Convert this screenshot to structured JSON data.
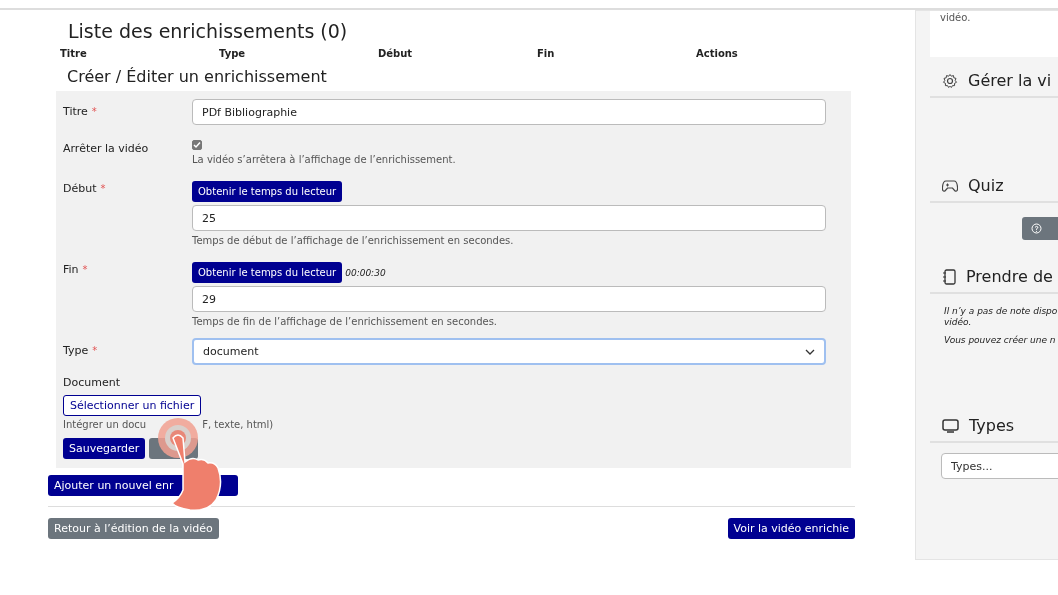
{
  "list": {
    "title": "Liste des enrichissements (0)",
    "columns": [
      "Titre",
      "Type",
      "Début",
      "Fin",
      "Actions"
    ]
  },
  "form": {
    "title": "Créer / Éditer un enrichissement",
    "fields": [
      {
        "kind": "text",
        "label": "Titre",
        "mark": "*",
        "value": "PDf Bibliographie"
      },
      {
        "kind": "checkbox",
        "label": "Arrêter la vidéo",
        "checked": true,
        "help": "La vidéo s’arrêtera à l’affichage de l’enrichissement."
      },
      {
        "kind": "time",
        "label": "Début",
        "mark": "*",
        "button": "Obtenir le temps du lecteur",
        "value": "25",
        "help": "Temps de début de l’affichage de l’enrichissement en secondes."
      },
      {
        "kind": "time",
        "label": "Fin",
        "mark": "*",
        "button": "Obtenir le temps du lecteur",
        "time": "00:00:30",
        "value": "29",
        "help": "Temps de fin de l’affichage de l’enrichissement en secondes."
      },
      {
        "kind": "select",
        "label": "Type",
        "mark": "*",
        "value": "document"
      },
      {
        "kind": "file",
        "label": "Document",
        "button": "Sélectionner un fichier",
        "help": [
          "Intégrer un docu",
          "F, texte, html)"
        ]
      }
    ],
    "buttons": [
      {
        "kind": "primary",
        "label": "Sauvegarder"
      },
      {
        "kind": "secondary"
      }
    ]
  },
  "add_button": "Ajouter un nouvel enr",
  "back_button": "Retour à l’édition de la vidéo",
  "view_button": "Voir la vidéo enrichie",
  "sidebar": {
    "intro_tail": "vidéo.",
    "sections": [
      {
        "kind": "manage",
        "title": "Gérer la vi"
      },
      {
        "kind": "quiz",
        "title": "Quiz"
      },
      {
        "kind": "notes",
        "title": "Prendre de",
        "notes": [
          "Il n’y a pas de note dispo",
          "vidéo.",
          "Vous pouvez créer une n"
        ]
      },
      {
        "kind": "types",
        "title": "Types",
        "placeholder": "Types..."
      }
    ]
  }
}
